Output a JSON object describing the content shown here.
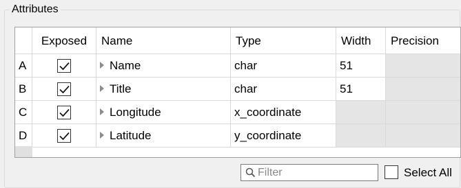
{
  "groupbox": {
    "title": "Attributes"
  },
  "table": {
    "columns": [
      "Exposed",
      "Name",
      "Type",
      "Width",
      "Precision"
    ],
    "rows": [
      {
        "header": "A",
        "exposed": true,
        "name": "Name",
        "type": "char",
        "width": "51",
        "precision": "",
        "width_disabled": false,
        "precision_disabled": true
      },
      {
        "header": "B",
        "exposed": true,
        "name": "Title",
        "type": "char",
        "width": "51",
        "precision": "",
        "width_disabled": false,
        "precision_disabled": true
      },
      {
        "header": "C",
        "exposed": true,
        "name": "Longitude",
        "type": "x_coordinate",
        "width": "",
        "precision": "",
        "width_disabled": true,
        "precision_disabled": true
      },
      {
        "header": "D",
        "exposed": true,
        "name": "Latitude",
        "type": "y_coordinate",
        "width": "",
        "precision": "",
        "width_disabled": true,
        "precision_disabled": true
      }
    ]
  },
  "filter": {
    "placeholder": "Filter",
    "value": ""
  },
  "select_all": {
    "label": "Select All",
    "checked": false
  }
}
